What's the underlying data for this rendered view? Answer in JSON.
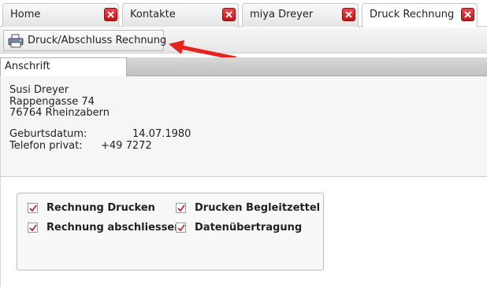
{
  "tabs": [
    {
      "label": "Home",
      "active": false
    },
    {
      "label": "Kontakte",
      "active": false
    },
    {
      "label": "miya Dreyer",
      "active": false
    },
    {
      "label": "Druck Rechnung",
      "active": true
    }
  ],
  "toolbar": {
    "print_button_label": "Druck/Abschluss Rechnung",
    "print_icon": "printer-icon",
    "annotation_arrow_color": "#e8221c"
  },
  "section_tab": {
    "label": "Anschrift"
  },
  "address": {
    "name": "Susi Dreyer",
    "street": "Rappengasse 74",
    "city": "76764 Rheinzabern",
    "birthdate_label": "Geburtsdatum:",
    "birthdate_value": "14.07.1980",
    "phone_label": "Telefon privat:",
    "phone_value": "+49 7272"
  },
  "options": [
    {
      "label": "Rechnung Drucken",
      "checked": true
    },
    {
      "label": "Drucken Begleitzettel",
      "checked": true
    },
    {
      "label": "Rechnung abschliessen",
      "checked": true
    },
    {
      "label": "Datenübertragung",
      "checked": true
    }
  ],
  "colors": {
    "close_button": "#d42a2a",
    "checkmark": "#b52a2a"
  }
}
